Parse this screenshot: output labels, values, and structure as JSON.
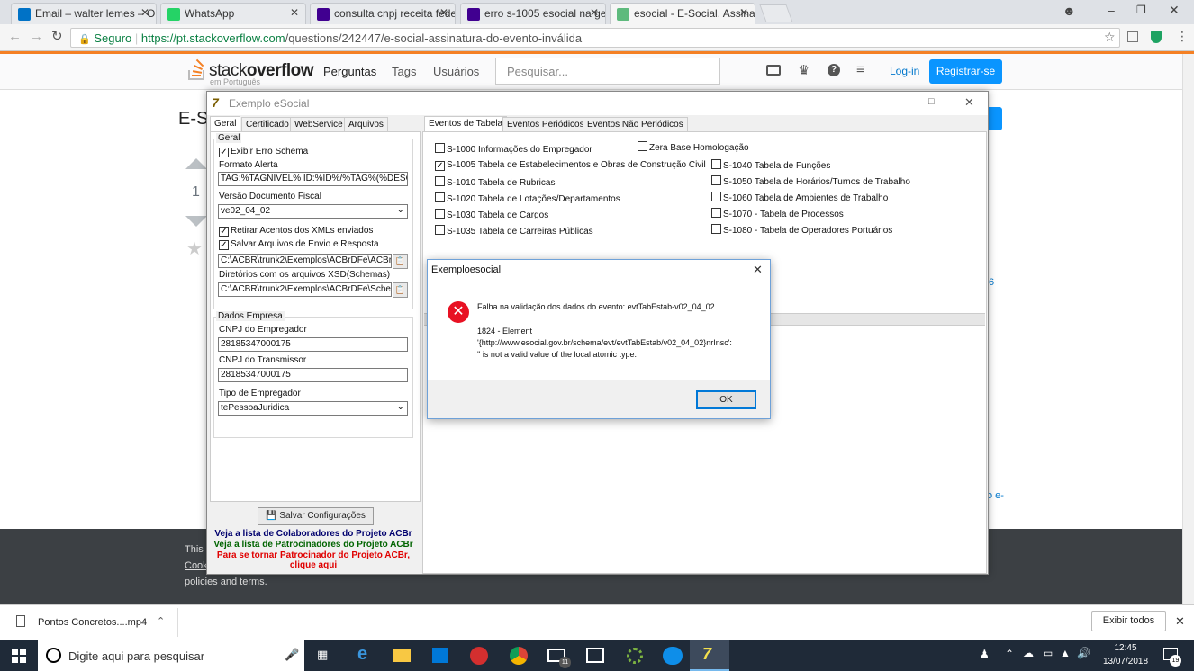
{
  "browser": {
    "tabs": [
      {
        "label": "Email – walter lemes – Ou",
        "icon": "outlook-icon",
        "color": "#0072c6"
      },
      {
        "label": "WhatsApp",
        "icon": "whatsapp-icon",
        "color": "#25d366"
      },
      {
        "label": "consulta cnpj receita fede",
        "icon": "yahoo-icon",
        "color": "#400090"
      },
      {
        "label": "erro s-1005 esocial na ge",
        "icon": "yahoo-icon",
        "color": "#400090"
      },
      {
        "label": "esocial - E-Social. Assinat",
        "icon": "stackoverflow-icon",
        "color": "#5eba7d"
      }
    ],
    "secure_label": "Seguro",
    "url_host": "https://pt.stackoverflow.com",
    "url_path": "/questions/242447/e-social-assinatura-do-evento-inválida"
  },
  "so": {
    "logo_main_a": "stack",
    "logo_main_b": "overflow",
    "logo_sub": "em Português",
    "nav": [
      "Perguntas",
      "Tags",
      "Usuários"
    ],
    "search_placeholder": "Pesquisar...",
    "login": "Log-in",
    "register": "Registrar-se",
    "question_title_partial": "E-S",
    "vote_count": "1",
    "side_fragments": [
      "6",
      "o e-"
    ],
    "footer_lines": [
      "This",
      "Cook",
      "policies and terms."
    ]
  },
  "app": {
    "title": "Exemplo eSocial",
    "left_tabs": [
      "Geral",
      "Certificado",
      "WebService",
      "Arquivos"
    ],
    "group_geral": "Geral",
    "chk_exibir": "Exibir Erro Schema",
    "lbl_formato": "Formato Alerta",
    "val_formato": "TAG:%TAGNIVEL% ID:%ID%/%TAG%(%DESCRI",
    "lbl_versao": "Versão Documento Fiscal",
    "val_versao": "ve02_04_02",
    "chk_retirar": "Retirar Acentos dos XMLs enviados",
    "chk_salvar": "Salvar Arquivos de Envio e Resposta",
    "val_path1": "C:\\ACBR\\trunk2\\Exemplos\\ACBrDFe\\ACBreSo",
    "lbl_dirs": "Diretórios com os arquivos XSD(Schemas)",
    "val_path2": "C:\\ACBR\\trunk2\\Exemplos\\ACBrDFe\\Schema",
    "group_empresa": "Dados Empresa",
    "lbl_cnpj_emp": "CNPJ do Empregador",
    "val_cnpj_emp": "28185347000175",
    "lbl_cnpj_trans": "CNPJ do Transmissor",
    "val_cnpj_trans": "28185347000175",
    "lbl_tipo": "Tipo de Empregador",
    "val_tipo": "tePessoaJuridica",
    "btn_salvar": "Salvar Configurações",
    "link1": "Veja a lista de Colaboradores do Projeto ACBr",
    "link2": "Veja a lista de Patrocinadores do Projeto ACBr",
    "link3a": "Para se tornar Patrocinador do Projeto ACBr,",
    "link3b": "clique aqui",
    "right_tabs": [
      "Eventos de Tabela",
      "Eventos Periódicos",
      "Eventos Não Periódicos"
    ],
    "zera_base": "Zera Base Homologação",
    "events_left": [
      {
        "label": "S-1000 Informações do Empregador",
        "checked": false
      },
      {
        "label": "S-1005 Tabela de Estabelecimentos e Obras de Construção Civil",
        "checked": true
      },
      {
        "label": "S-1010 Tabela de Rubricas",
        "checked": false
      },
      {
        "label": "S-1020 Tabela de Lotações/Departamentos",
        "checked": false
      },
      {
        "label": "S-1030 Tabela de Cargos",
        "checked": false
      },
      {
        "label": "S-1035 Tabela de Carreiras Públicas",
        "checked": false
      }
    ],
    "events_right": [
      {
        "label": "S-1040 Tabela de Funções",
        "checked": false
      },
      {
        "label": "S-1050 Tabela de Horários/Turnos de Trabalho",
        "checked": false
      },
      {
        "label": "S-1060 Tabela de Ambientes de Trabalho",
        "checked": false
      },
      {
        "label": "S-1070 - Tabela de Processos",
        "checked": false
      },
      {
        "label": "S-1080 - Tabela de Operadores Portuários",
        "checked": false
      }
    ]
  },
  "dialog": {
    "title": "Exemploesocial",
    "line1": "Falha na validação dos dados do evento: evtTabEstab-v02_04_02",
    "line2": "1824 - Element",
    "line3": "'{http://www.esocial.gov.br/schema/evt/evtTabEstab/v02_04_02}nrInsc':",
    "line4": "'' is not a valid value of the local atomic type.",
    "ok": "OK"
  },
  "downloads": {
    "file": "Pontos Concretos....mp4",
    "show_all": "Exibir todos"
  },
  "taskbar": {
    "search": "Digite aqui para pesquisar",
    "time": "12:45",
    "date": "13/07/2018",
    "notif": "19",
    "badge": "11"
  }
}
